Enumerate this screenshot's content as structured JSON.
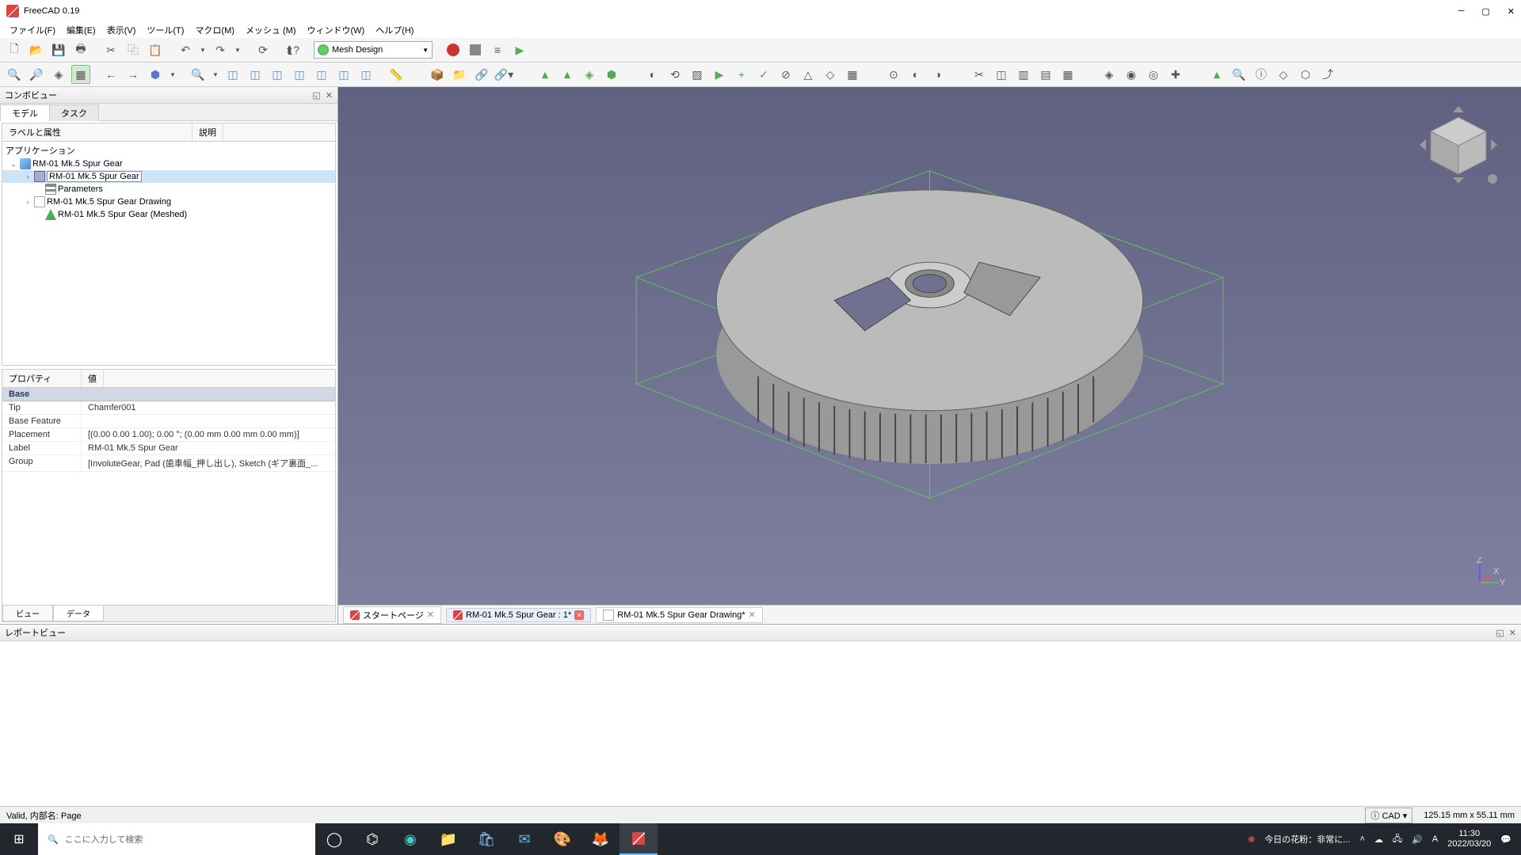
{
  "title": "FreeCAD 0.19",
  "menu": [
    "ファイル(F)",
    "編集(E)",
    "表示(V)",
    "ツール(T)",
    "マクロ(M)",
    "メッシュ (M)",
    "ウィンドウ(W)",
    "ヘルプ(H)"
  ],
  "workbench": "Mesh Design",
  "combo": {
    "title": "コンボビュー",
    "tabs": [
      "モデル",
      "タスク"
    ],
    "tree_headers": [
      "ラベルと属性",
      "説明"
    ],
    "app_label": "アプリケーション",
    "doc_name": "RM-01 Mk.5 Spur Gear",
    "nodes": {
      "body": "RM-01 Mk.5 Spur Gear",
      "params": "Parameters",
      "drawing": "RM-01 Mk.5 Spur Gear Drawing",
      "mesh": "RM-01 Mk.5 Spur Gear (Meshed)"
    }
  },
  "props": {
    "headers": [
      "プロパティ",
      "値"
    ],
    "category": "Base",
    "rows": {
      "tip_k": "Tip",
      "tip_v": "Chamfer001",
      "bf_k": "Base Feature",
      "bf_v": "",
      "pl_k": "Placement",
      "pl_v": "[(0.00 0.00 1.00); 0.00 °; (0.00 mm  0.00 mm  0.00 mm)]",
      "lb_k": "Label",
      "lb_v": "RM-01 Mk.5 Spur Gear",
      "gr_k": "Group",
      "gr_v": "[InvoluteGear, Pad (歯車幅_押し出し), Sketch (ギア裏面_..."
    },
    "bottom_tabs": [
      "ビュー",
      "データ"
    ]
  },
  "doc_tabs": {
    "start": "スタートページ",
    "model": "RM-01 Mk.5 Spur Gear : 1*",
    "drawing": "RM-01 Mk.5 Spur Gear Drawing*"
  },
  "report_title": "レポートビュー",
  "status": {
    "left": "Valid, 内部名: Page",
    "cad": "CAD",
    "dims": "125.15 mm x 55.11 mm"
  },
  "taskbar": {
    "search_placeholder": "ここに入力して検索",
    "weather": "今日の花粉：非常に...",
    "time": "11:30",
    "date": "2022/03/20"
  }
}
